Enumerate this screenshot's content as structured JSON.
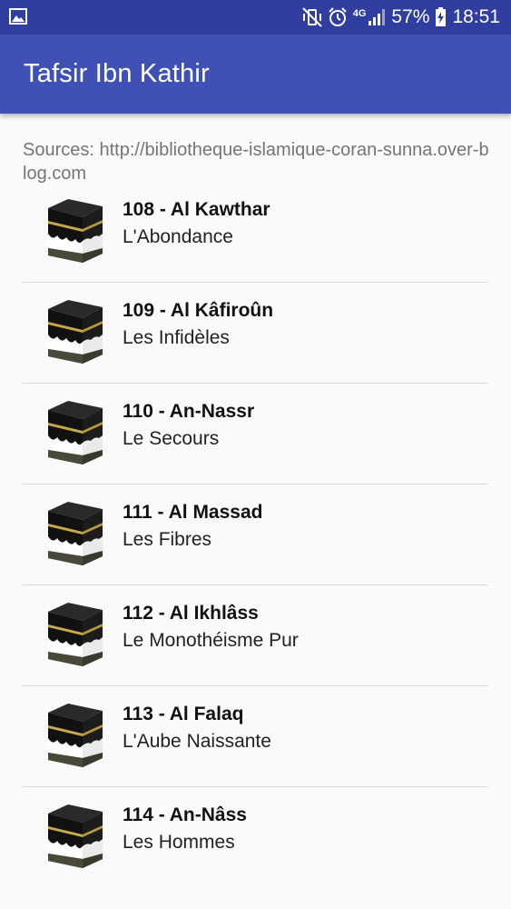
{
  "status_bar": {
    "battery_percent": "57%",
    "time": "18:51",
    "network": "4G"
  },
  "app_bar": {
    "title": "Tafsir Ibn Kathir"
  },
  "sources": "Sources:  http://bibliotheque-islamique-coran-sunna.over-blog.com",
  "items": [
    {
      "name": "108 - Al Kawthar",
      "translation": "L'Abondance"
    },
    {
      "name": "109 - Al Kâfiroûn",
      "translation": "Les Infidèles"
    },
    {
      "name": "110 - An-Nassr",
      "translation": "Le Secours"
    },
    {
      "name": "111 - Al Massad",
      "translation": "Les Fibres"
    },
    {
      "name": "112 - Al Ikhlâss",
      "translation": "Le Monothéisme Pur"
    },
    {
      "name": "113 - Al Falaq",
      "translation": "L'Aube Naissante"
    },
    {
      "name": "114 - An-Nâss",
      "translation": "Les Hommes"
    }
  ],
  "icons": {
    "status_left": "image-notification-icon",
    "mute": "vibrate-mute-icon",
    "alarm": "alarm-icon",
    "signal": "signal-icon",
    "battery": "battery-charging-icon",
    "thumb": "kaaba-icon"
  }
}
